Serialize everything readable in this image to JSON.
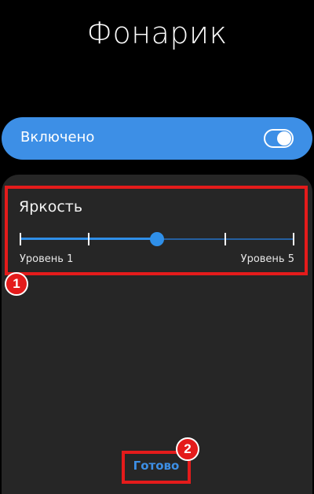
{
  "screen": {
    "title": "Фонарик"
  },
  "toggle": {
    "label": "Включено",
    "state": "on"
  },
  "brightness": {
    "title": "Яркость",
    "min_label": "Уровень 1",
    "max_label": "Уровень 5",
    "levels": 5,
    "current_level": 3
  },
  "annotations": {
    "badge_1": "1",
    "badge_2": "2"
  },
  "footer": {
    "done_label": "Готово"
  },
  "colors": {
    "accent": "#3d8fe6",
    "highlight": "#e41b1b",
    "panel": "#262626",
    "background": "#000000"
  }
}
